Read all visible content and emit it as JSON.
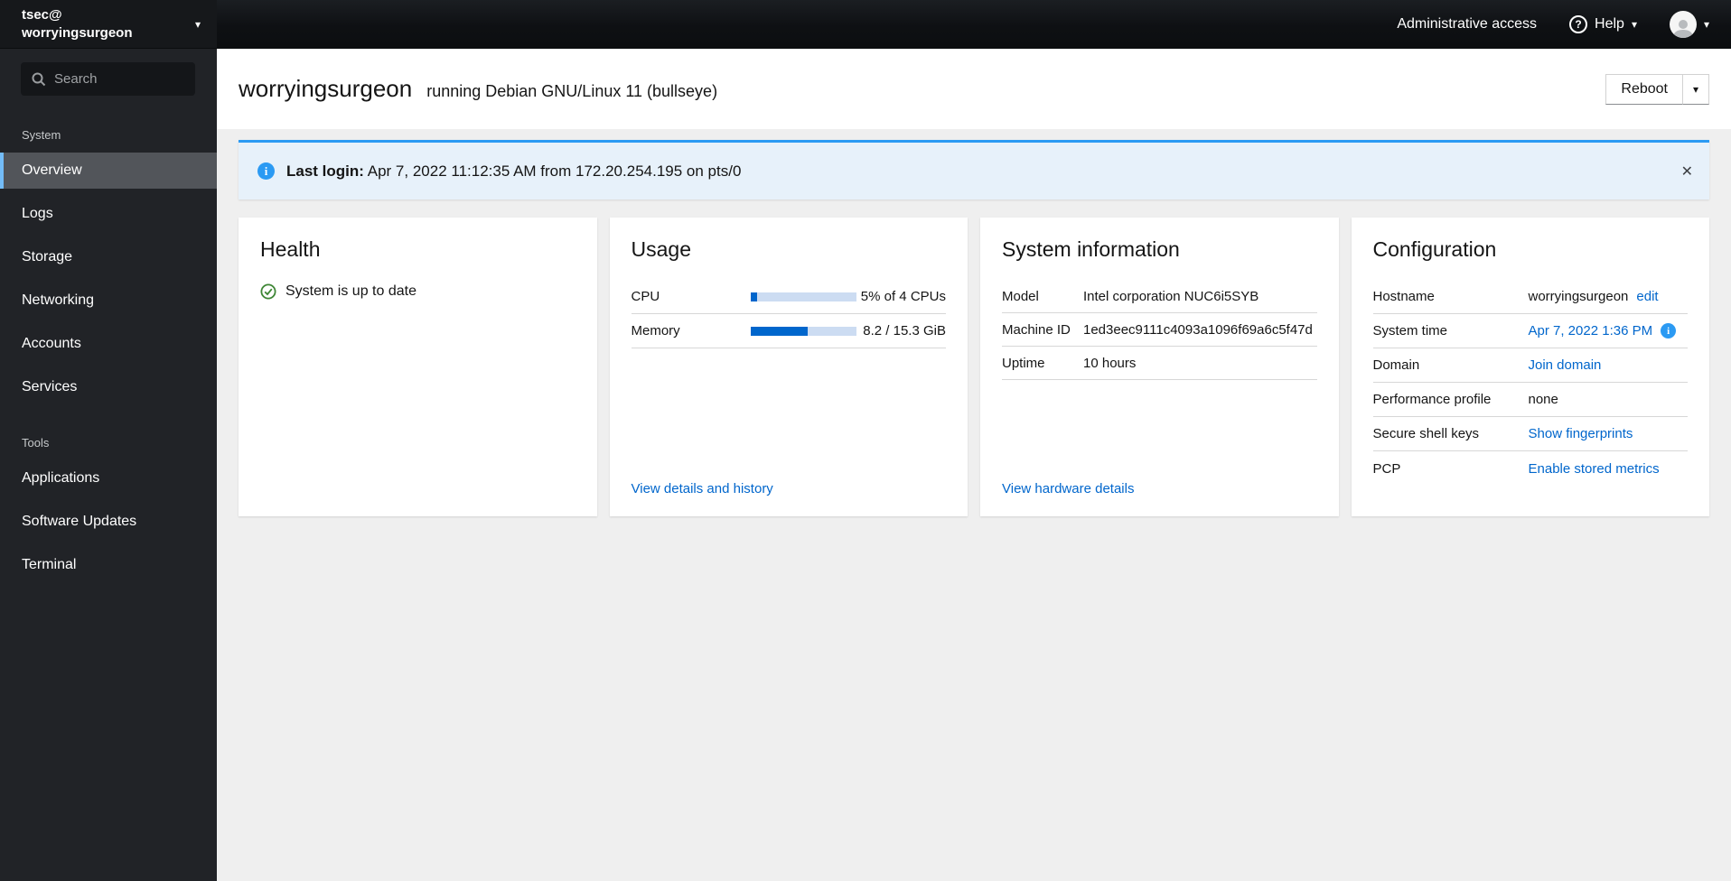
{
  "colors": {
    "accent_link": "#0066cc",
    "info_blue": "#2b9af3",
    "success_green": "#3e8635",
    "progress_fill": "#0066cc",
    "progress_track": "#ccdcf2",
    "nav_selected_border": "#73bcf7"
  },
  "sidebar": {
    "user": {
      "account": "tsec@",
      "host": "worryingsurgeon"
    },
    "search_placeholder": "Search",
    "sections": [
      {
        "label": "System",
        "items": [
          {
            "label": "Overview",
            "selected": true
          },
          {
            "label": "Logs"
          },
          {
            "label": "Storage"
          },
          {
            "label": "Networking"
          },
          {
            "label": "Accounts"
          },
          {
            "label": "Services"
          }
        ]
      },
      {
        "label": "Tools",
        "items": [
          {
            "label": "Applications"
          },
          {
            "label": "Software Updates"
          },
          {
            "label": "Terminal"
          }
        ]
      }
    ]
  },
  "masthead": {
    "admin_label": "Administrative access",
    "help_label": "Help"
  },
  "page_header": {
    "hostname": "worryingsurgeon",
    "os": "running Debian GNU/Linux 11 (bullseye)",
    "reboot_label": "Reboot"
  },
  "alert": {
    "title": "Last login:",
    "message": "Apr 7, 2022 11:12:35 AM from 172.20.254.195 on pts/0"
  },
  "cards": {
    "health": {
      "title": "Health",
      "status": "System is up to date"
    },
    "usage": {
      "title": "Usage",
      "rows": [
        {
          "label": "CPU",
          "percent": 6,
          "value": "5% of 4 CPUs"
        },
        {
          "label": "Memory",
          "percent": 54,
          "value": "8.2 / 15.3 GiB"
        }
      ],
      "link": "View details and history"
    },
    "system_information": {
      "title": "System information",
      "rows": [
        {
          "label": "Model",
          "value": "Intel corporation NUC6i5SYB"
        },
        {
          "label": "Machine ID",
          "value": "1ed3eec9111c4093a1096f69a6c5f47d"
        },
        {
          "label": "Uptime",
          "value": "10 hours"
        }
      ],
      "link": "View hardware details"
    },
    "configuration": {
      "title": "Configuration",
      "rows": [
        {
          "label": "Hostname",
          "value": "worryingsurgeon",
          "link": "edit"
        },
        {
          "label": "System time",
          "link": "Apr 7, 2022 1:36 PM"
        },
        {
          "label": "Domain",
          "link": "Join domain"
        },
        {
          "label": "Performance profile",
          "value": "none"
        },
        {
          "label": "Secure shell keys",
          "link": "Show fingerprints"
        },
        {
          "label": "PCP",
          "link": "Enable stored metrics"
        }
      ]
    }
  },
  "icons": {
    "caret": "▾",
    "close": "✕",
    "help": "?",
    "info": "i"
  }
}
